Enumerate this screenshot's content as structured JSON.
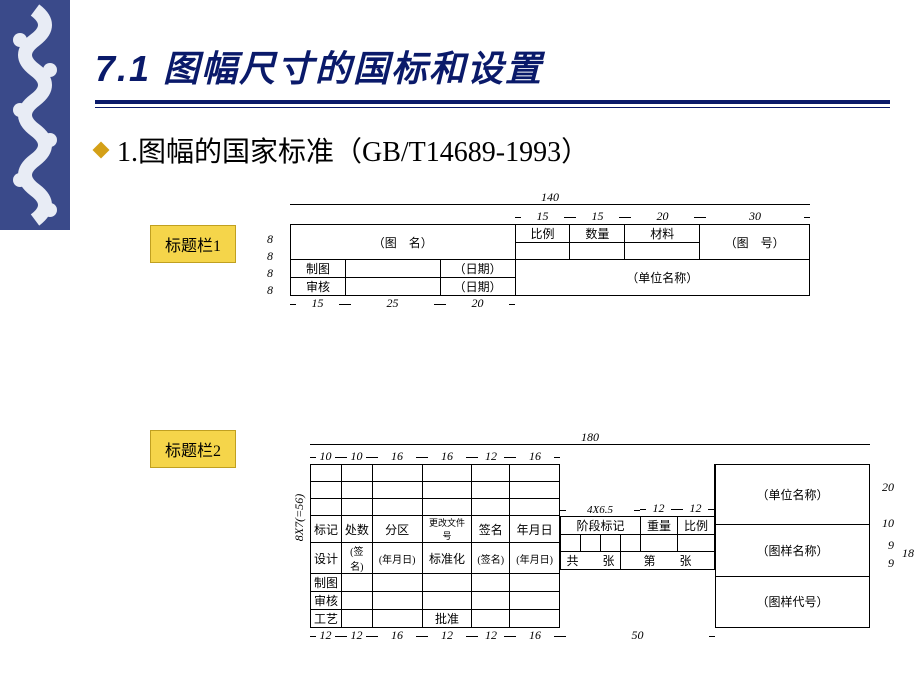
{
  "title": "7.1 图幅尺寸的国标和设置",
  "subhead": "1.图幅的国家标准（GB/T14689-1993）",
  "tag1": "标题栏1",
  "tag2": "标题栏2",
  "tb1": {
    "total_width": "140",
    "top_dims": {
      "d1": "15",
      "d2": "15",
      "d3": "20",
      "d4": "30"
    },
    "row_h": "8",
    "bot_dims": {
      "b1": "15",
      "b2": "25",
      "b3": "20"
    },
    "cells": {
      "tuming": "（图　名）",
      "bili": "比例",
      "shuliang": "数量",
      "cailiao": "材料",
      "tuhao": "（图　号）",
      "zhitu": "制图",
      "riqi1": "（日期）",
      "shenhe": "审核",
      "riqi2": "（日期）",
      "danwei": "（单位名称）"
    }
  },
  "tb2": {
    "total_width": "180",
    "left_h_label": "8X7(=56)",
    "top_dims": [
      "10",
      "10",
      "16",
      "16",
      "12",
      "16"
    ],
    "bot_dims_left": [
      "12",
      "12",
      "16",
      "12",
      "12",
      "16"
    ],
    "bot_right_dim": "50",
    "mid_dims": {
      "a": "4X6.5",
      "b": "12",
      "c": "12"
    },
    "right_h": {
      "h1": "20",
      "h2": "10",
      "h3": "9",
      "h4": "9",
      "h_total": "18"
    },
    "cells": {
      "biaoji": "标记",
      "chushu": "处数",
      "fenqu": "分区",
      "gengai": "更改文件号",
      "qianming": "签名",
      "nianyueri": "年月日",
      "sheji": "设计",
      "qianming2": "(签名)",
      "nyr2": "(年月日)",
      "biaozhunhua": "标准化",
      "qianming3": "(签名)",
      "nyr3": "(年月日)",
      "zhitu": "制图",
      "shenhe": "审核",
      "gongyi": "工艺",
      "pizhun": "批准",
      "jieduan": "阶段标记",
      "zhongliang": "重量",
      "bili": "比例",
      "gong": "共　　张",
      "di": "第　　张",
      "danwei": "（单位名称）",
      "tuyangmc": "（图样名称）",
      "tuyangdh": "（图样代号）"
    }
  }
}
